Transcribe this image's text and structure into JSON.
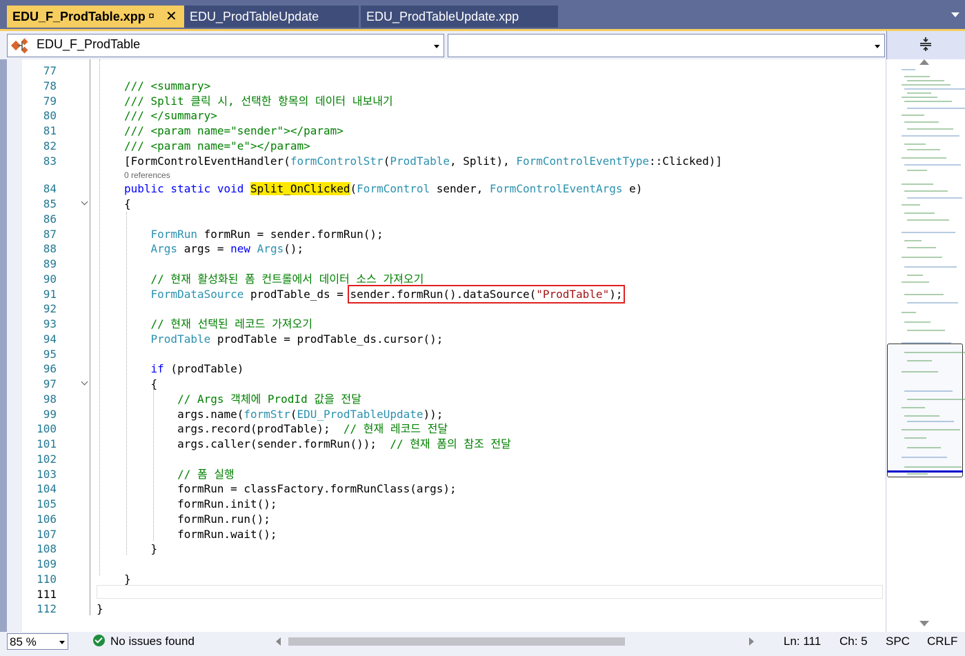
{
  "tabs": [
    {
      "label": "EDU_F_ProdTable.xpp",
      "active": true
    },
    {
      "label": "EDU_ProdTableUpdate",
      "active": false
    },
    {
      "label": "EDU_ProdTableUpdate.xpp",
      "active": false
    }
  ],
  "tab_pin_glyph": "¤",
  "tab_close_glyph": "✕",
  "nav": {
    "class_combo": "EDU_F_ProdTable",
    "member_combo": "",
    "split_glyph": "≠"
  },
  "codelens": "0 references",
  "code_lines": [
    {
      "n": "77",
      "html": ""
    },
    {
      "n": "78",
      "html": "<span class='cm'>/// &lt;summary&gt;</span>"
    },
    {
      "n": "79",
      "html": "<span class='cm'>/// Split 클릭 시, 선택한 항목의 데이터 내보내기</span>"
    },
    {
      "n": "80",
      "html": "<span class='cm'>/// &lt;/summary&gt;</span>"
    },
    {
      "n": "81",
      "html": "<span class='cm'>/// &lt;param name=\"sender\"&gt;&lt;/param&gt;</span>"
    },
    {
      "n": "82",
      "html": "<span class='cm'>/// &lt;param name=\"e\"&gt;&lt;/param&gt;</span>"
    },
    {
      "n": "83",
      "html": "[FormControlEventHandler(<span class='ty'>formControlStr</span>(<span class='ty'>ProdTable</span>, Split), <span class='ty'>FormControlEventType</span>::Clicked)]"
    },
    {
      "n": "84",
      "html": "<span class='kw'>public static void</span> <span class='hl'>Split_OnClicked</span>(<span class='ty'>FormControl</span> sender, <span class='ty'>FormControlEventArgs</span> e)"
    },
    {
      "n": "85",
      "html": "{"
    },
    {
      "n": "86",
      "html": ""
    },
    {
      "n": "87",
      "html": "    <span class='ty'>FormRun</span> formRun = sender.formRun();"
    },
    {
      "n": "88",
      "html": "    <span class='ty'>Args</span> args = <span class='kw'>new</span> <span class='ty'>Args</span>();"
    },
    {
      "n": "89",
      "html": ""
    },
    {
      "n": "90",
      "html": "    <span class='cm'>// 현재 활성화된 폼 컨트롤에서 데이터 소스 가져오기</span>"
    },
    {
      "n": "91",
      "html": "    <span class='ty'>FormDataSource</span> prodTable_ds = <span class='redbox'>sender.formRun().dataSource(<span class='str'>\"ProdTable\"</span>);</span>"
    },
    {
      "n": "92",
      "html": ""
    },
    {
      "n": "93",
      "html": "    <span class='cm'>// 현재 선택된 레코드 가져오기</span>"
    },
    {
      "n": "94",
      "html": "    <span class='ty'>ProdTable</span> prodTable = prodTable_ds.cursor();"
    },
    {
      "n": "95",
      "html": ""
    },
    {
      "n": "96",
      "html": "    <span class='kw'>if</span> (prodTable)"
    },
    {
      "n": "97",
      "html": "    {"
    },
    {
      "n": "98",
      "html": "        <span class='cm'>// Args 객체에 ProdId 값을 전달</span>"
    },
    {
      "n": "99",
      "html": "        args.name(<span class='ty'>formStr</span>(<span class='ty'>EDU_ProdTableUpdate</span>));"
    },
    {
      "n": "100",
      "html": "        args.record(prodTable);  <span class='cm'>// 현재 레코드 전달</span>"
    },
    {
      "n": "101",
      "html": "        args.caller(sender.formRun());  <span class='cm'>// 현재 폼의 참조 전달</span>"
    },
    {
      "n": "102",
      "html": ""
    },
    {
      "n": "103",
      "html": "        <span class='cm'>// 폼 실행</span>"
    },
    {
      "n": "104",
      "html": "        formRun = classFactory.formRunClass(args);"
    },
    {
      "n": "105",
      "html": "        formRun.init();"
    },
    {
      "n": "106",
      "html": "        formRun.run();"
    },
    {
      "n": "107",
      "html": "        formRun.wait();"
    },
    {
      "n": "108",
      "html": "    }"
    },
    {
      "n": "109",
      "html": ""
    },
    {
      "n": "110",
      "html": "}"
    },
    {
      "n": "111",
      "html": ""
    },
    {
      "n": "112",
      "html": "}"
    }
  ],
  "status": {
    "zoom": "85 %",
    "issues": "No issues found",
    "line": "Ln: 111",
    "col": "Ch: 5",
    "spc": "SPC",
    "crlf": "CRLF"
  },
  "colors": {
    "active_tab": "#f6cd5f",
    "inactive_tab": "#3f4d7a",
    "keyword": "#0000ff",
    "type": "#2b91af",
    "comment": "#008000",
    "string": "#a31515",
    "highlight": "#ffe800",
    "callout_box": "#e02020"
  },
  "icons": [
    "pin-icon",
    "close-icon",
    "class-icon",
    "split-window-icon",
    "no-issues-check-icon"
  ]
}
